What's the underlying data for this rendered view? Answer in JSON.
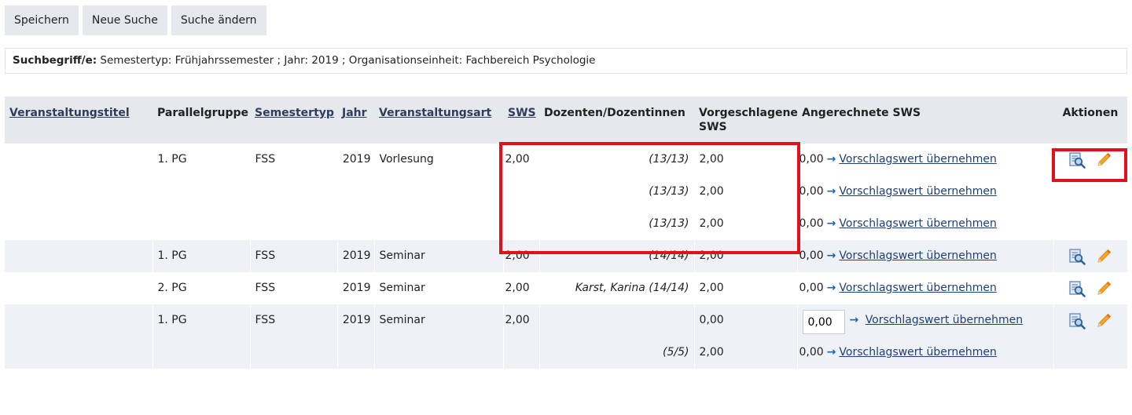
{
  "toolbar": {
    "save_label": "Speichern",
    "new_search_label": "Neue Suche",
    "change_search_label": "Suche ändern"
  },
  "criteria": {
    "label": "Suchbegriff/e:",
    "text": " Semestertyp: Frühjahrssemester ;  Jahr: 2019 ;  Organisationseinheit: Fachbereich Psychologie"
  },
  "table": {
    "headers": {
      "title": "Veranstaltungstitel",
      "parallel": "Parallelgruppe",
      "semester": "Semestertyp",
      "year": "Jahr",
      "type": "Veranstaltungsart",
      "sws": "SWS",
      "lecturers": "Dozenten/Dozentinnen",
      "proposed": "Vorgeschlagene SWS",
      "credited": "Angerechnete SWS",
      "actions": "Aktionen"
    },
    "link_label": "Vorschlagswert übernehmen",
    "rows": [
      {
        "group": "1. PG",
        "semester": "FSS",
        "year": "2019",
        "type": "Vorlesung",
        "sws": "2,00",
        "lines": [
          {
            "lecturer": "(13/13)",
            "proposed": "2,00",
            "credited": "0,00"
          },
          {
            "lecturer": "(13/13)",
            "proposed": "2,00",
            "credited": "0,00"
          },
          {
            "lecturer": "(13/13)",
            "proposed": "2,00",
            "credited": "0,00"
          }
        ]
      },
      {
        "group": "1. PG",
        "semester": "FSS",
        "year": "2019",
        "type": "Seminar",
        "sws": "2,00",
        "lines": [
          {
            "lecturer": "(14/14)",
            "proposed": "2,00",
            "credited": "0,00"
          }
        ]
      },
      {
        "group": "2. PG",
        "semester": "FSS",
        "year": "2019",
        "type": "Seminar",
        "sws": "2,00",
        "lines": [
          {
            "lecturer": "Karst, Karina (14/14)",
            "proposed": "2,00",
            "credited": "0,00"
          }
        ]
      },
      {
        "group": "1. PG",
        "semester": "FSS",
        "year": "2019",
        "type": "Seminar",
        "sws": "2,00",
        "lines": [
          {
            "lecturer": "",
            "proposed": "0,00",
            "credited": "0,00",
            "input": true
          },
          {
            "lecturer": "(5/5)",
            "proposed": "2,00",
            "credited": "0,00"
          }
        ]
      }
    ]
  },
  "colors": {
    "header_bg": "#e5e9ee",
    "row_alt_bg": "#eef2f6",
    "arrow": "#1b63b4",
    "highlight_box": "#e0101c",
    "edit_icon": "#f0a020"
  },
  "icons": {
    "details": "magnifier-document-icon",
    "edit": "pencil-icon",
    "arrow": "arrow-right-icon"
  }
}
